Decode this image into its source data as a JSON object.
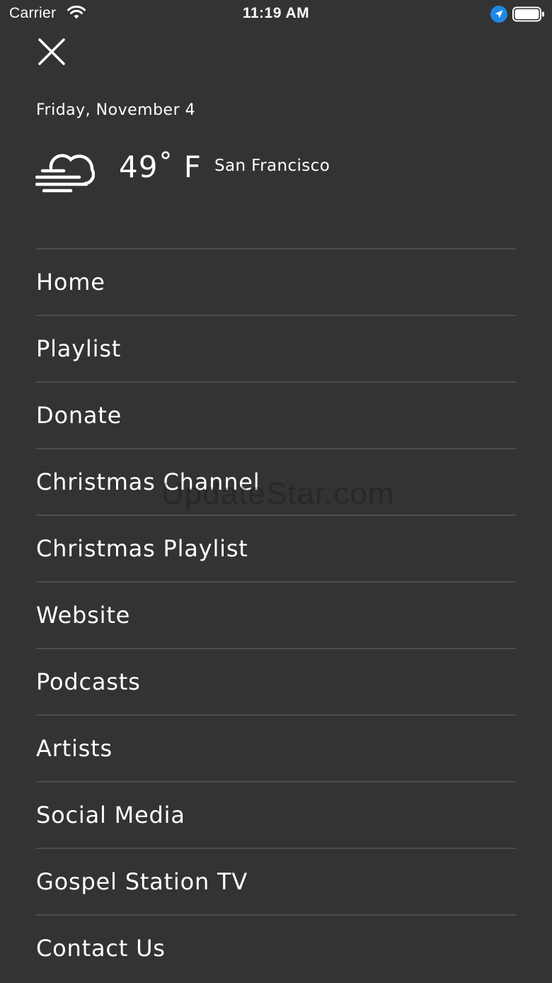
{
  "status_bar": {
    "carrier": "Carrier",
    "time": "11:19 AM",
    "icons": [
      "wifi-icon",
      "location-arrow-icon",
      "battery-icon"
    ]
  },
  "header": {
    "close_icon": "close-icon",
    "date": "Friday, November 4"
  },
  "weather": {
    "icon": "cloud-fog-icon",
    "temperature": "49˚ F",
    "city": "San Francisco"
  },
  "menu": {
    "items": [
      {
        "label": "Home"
      },
      {
        "label": "Playlist"
      },
      {
        "label": "Donate"
      },
      {
        "label": "Christmas Channel"
      },
      {
        "label": "Christmas Playlist"
      },
      {
        "label": "Website"
      },
      {
        "label": "Podcasts"
      },
      {
        "label": "Artists"
      },
      {
        "label": "Social Media"
      },
      {
        "label": "Gospel Station TV"
      },
      {
        "label": "Contact Us"
      }
    ]
  },
  "watermark": "UpdateStar.com",
  "colors": {
    "background": "#333333",
    "text": "#ffffff",
    "divider": "#4d4d4d",
    "location_badge": "#1e88e5"
  }
}
